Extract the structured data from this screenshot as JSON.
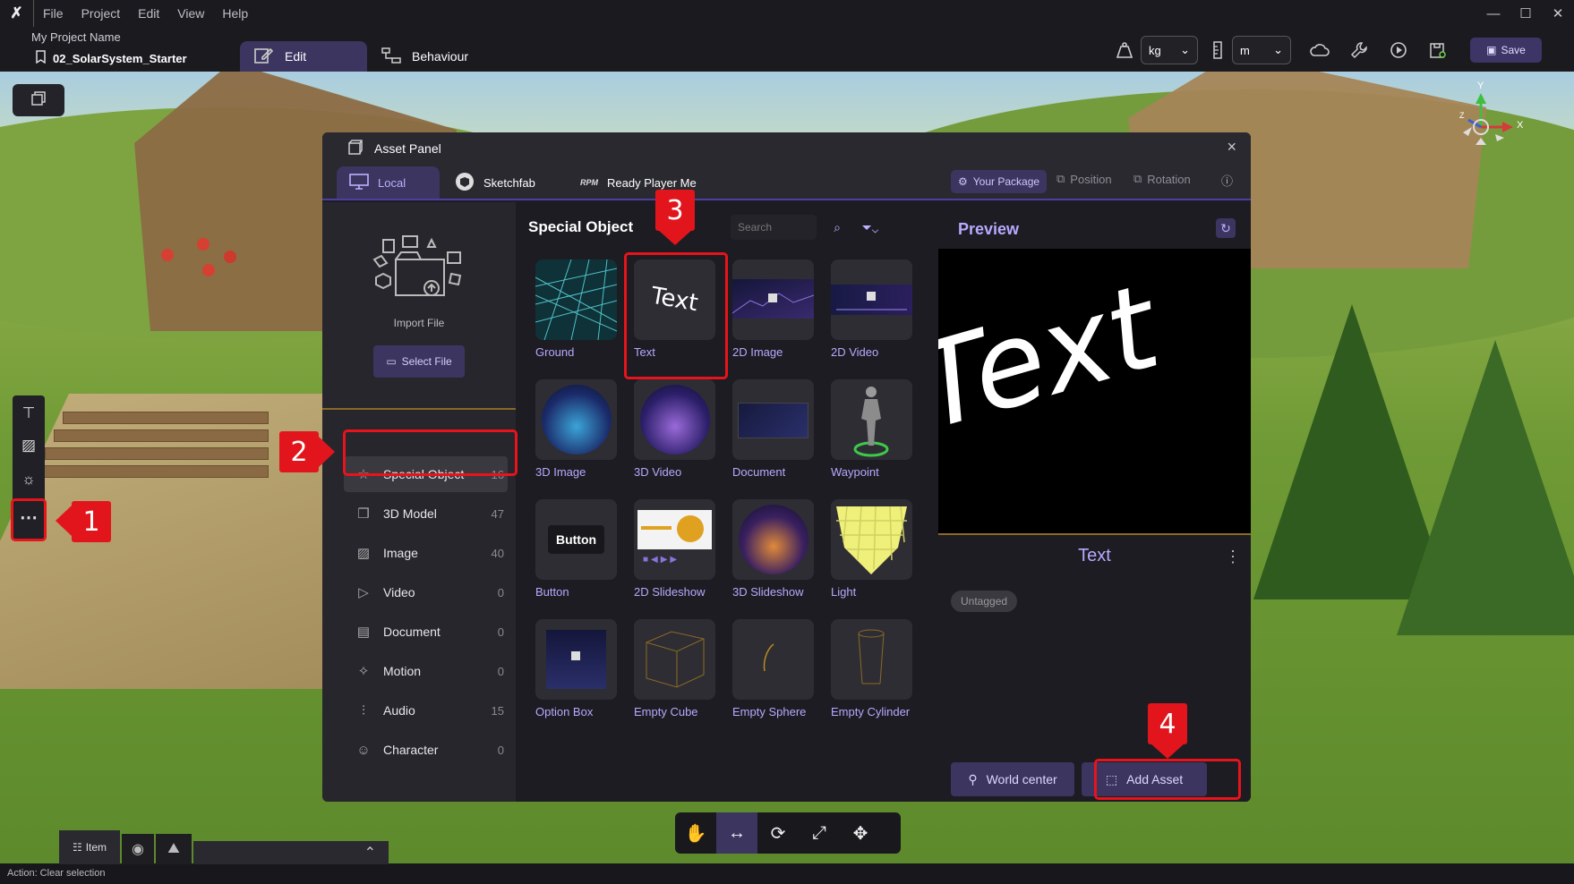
{
  "menubar": {
    "items": [
      "File",
      "Project",
      "Edit",
      "View",
      "Help"
    ]
  },
  "window_controls": {
    "minimize": "—",
    "maximize": "☐",
    "close": "✕"
  },
  "project": {
    "name": "My Project Name",
    "file": "02_SolarSystem_Starter"
  },
  "modes": {
    "edit": "Edit",
    "behaviour": "Behaviour"
  },
  "units": {
    "mass": "kg",
    "length": "m"
  },
  "toolbar": {
    "save": "Save"
  },
  "panel": {
    "title": "Asset Panel",
    "close": "×",
    "tabs": {
      "local": "Local",
      "sketchfab": "Sketchfab",
      "rpm": "Ready Player Me"
    },
    "right_tabs": {
      "package": "Your Package",
      "position": "Position",
      "rotation": "Rotation"
    },
    "import_label": "Import File",
    "select_file": "Select File",
    "categories": [
      {
        "label": "Special Object",
        "count": "16"
      },
      {
        "label": "3D Model",
        "count": "47"
      },
      {
        "label": "Image",
        "count": "40"
      },
      {
        "label": "Video",
        "count": "0"
      },
      {
        "label": "Document",
        "count": "0"
      },
      {
        "label": "Motion",
        "count": "0"
      },
      {
        "label": "Audio",
        "count": "15"
      },
      {
        "label": "Character",
        "count": "0"
      }
    ],
    "grid_title": "Special Object",
    "search_placeholder": "Search",
    "items": [
      "Ground",
      "Text",
      "2D Image",
      "2D Video",
      "3D Image",
      "3D Video",
      "Document",
      "Waypoint",
      "Button",
      "2D Slideshow",
      "3D Slideshow",
      "Light",
      "Option Box",
      "Empty Cube",
      "Empty Sphere",
      "Empty Cylinder"
    ],
    "thumb_text": {
      "text": "Text",
      "button": "Button"
    },
    "preview_title": "Preview",
    "preview_text": "Text",
    "detail_name": "Text",
    "tag": "Untagged",
    "world_center": "World center",
    "add_asset": "Add Asset"
  },
  "annotations": [
    "1",
    "2",
    "3",
    "4"
  ],
  "bottom": {
    "item_tab": "Item"
  },
  "status": "Action: Clear selection",
  "axes": {
    "x": "X",
    "y": "Y",
    "z": "Z"
  },
  "colors": {
    "accent": "#3b3560",
    "accent_text": "#b6aaff",
    "highlight": "#e8131b"
  }
}
